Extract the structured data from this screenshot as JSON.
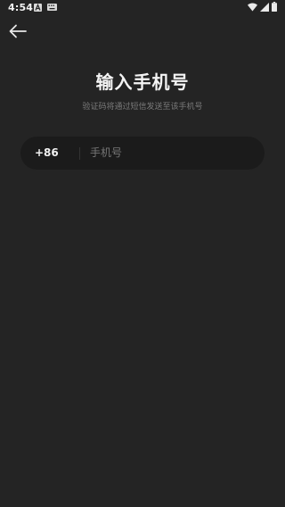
{
  "status_bar": {
    "time": "4:54",
    "icons": [
      "a-notification-icon",
      "keyboard-icon",
      "wifi-icon",
      "signal-icon",
      "battery-icon"
    ]
  },
  "nav": {
    "back_icon": "back-arrow-icon"
  },
  "header": {
    "title": "输入手机号",
    "subtitle": "验证码将通过短信发送至该手机号"
  },
  "phone_form": {
    "country_code": "+86",
    "phone_value": "",
    "phone_placeholder": "手机号"
  },
  "colors": {
    "background": "#242424",
    "field_background": "#1b1b1b",
    "primary_text": "#f5f5f5",
    "secondary_text": "#7a7a7a"
  }
}
